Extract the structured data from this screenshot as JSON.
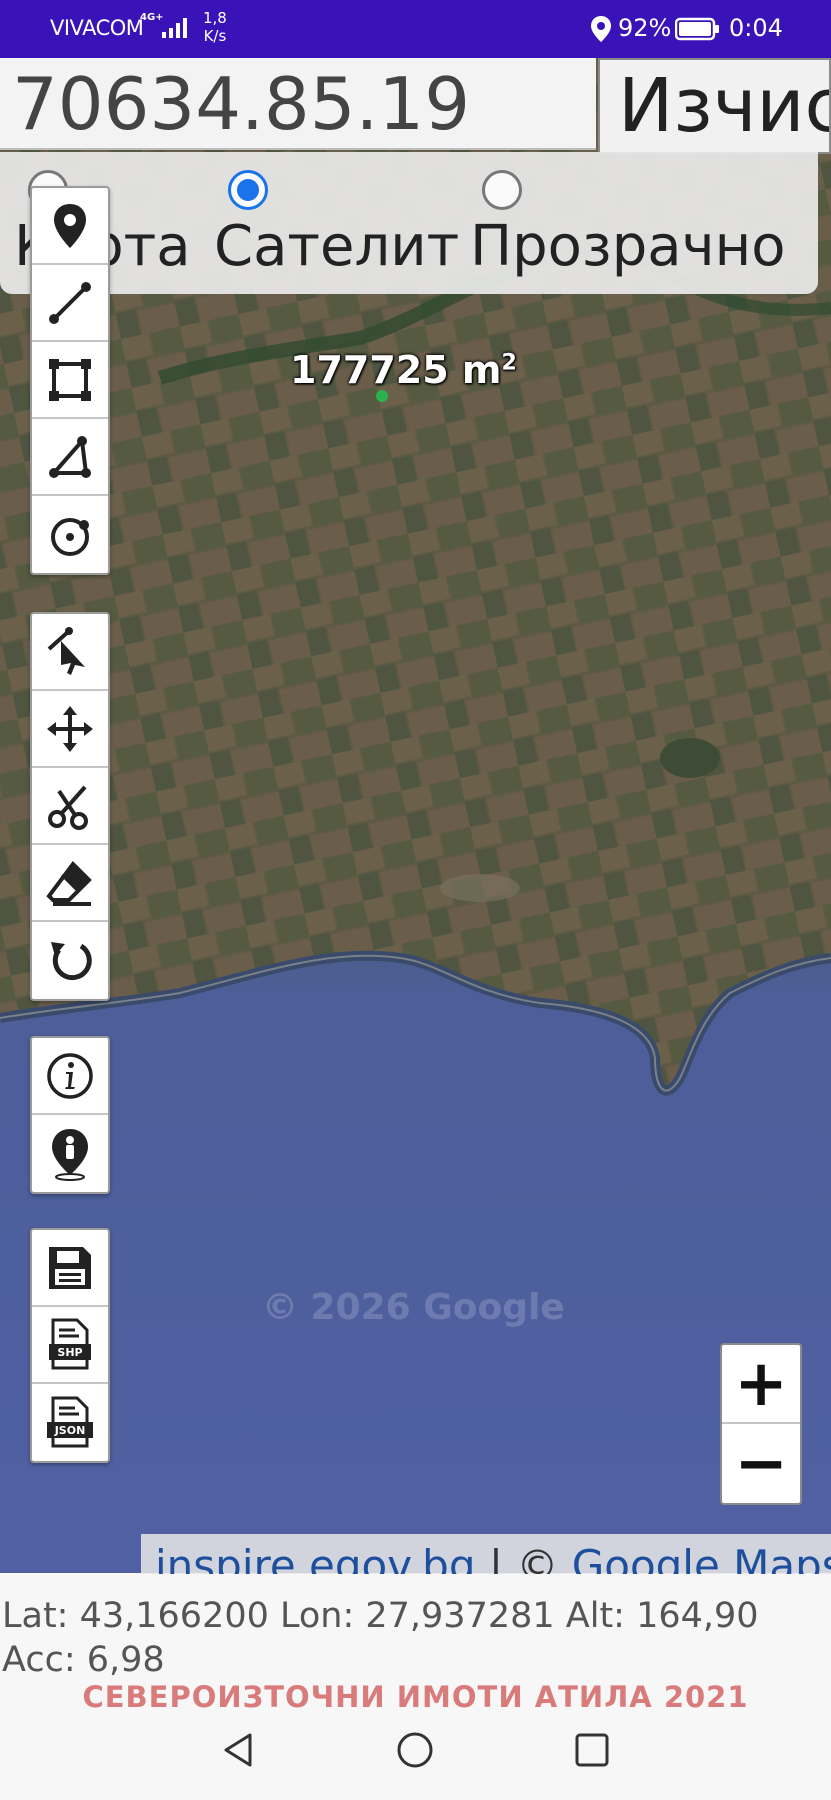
{
  "status_bar": {
    "carrier": "VIVACOM",
    "network": "4G+",
    "speed_value": "1,8",
    "speed_unit": "K/s",
    "battery": "92%",
    "time": "0:04"
  },
  "top": {
    "coord_input_value": "70634.85.19",
    "calc_button_label": "Изчис"
  },
  "layers": {
    "options": [
      {
        "label": "Карта",
        "checked": false
      },
      {
        "label": "Сателит",
        "checked": true
      },
      {
        "label": "Прозрачно",
        "checked": false
      }
    ]
  },
  "map": {
    "area_value": "177725 m",
    "area_sup": "2",
    "watermark": "© 2026 Google",
    "attribution_link1": "inspire.egov.bg",
    "attribution_sep": " | © ",
    "attribution_link2": "Google Maps"
  },
  "toolbar_groups": [
    [
      "marker-icon",
      "line-icon",
      "rectangle-icon",
      "angle-icon",
      "circle-icon"
    ],
    [
      "select-icon",
      "move-icon",
      "cut-icon",
      "eraser-icon",
      "undo-icon"
    ],
    [
      "info-icon",
      "my-location-icon"
    ],
    [
      "save-icon",
      "shp-export-icon",
      "json-export-icon"
    ]
  ],
  "zoom": {
    "in": "+",
    "out": "−"
  },
  "gps": {
    "text": "Lat: 43,166200 Lon: 27,937281 Alt: 164,90 Acc: 6,98"
  },
  "footer": "СЕВЕРОИЗТОЧНИ ИМОТИ АТИЛА 2021",
  "colors": {
    "status_bar": "#3a13b8",
    "accent": "#1a73e8",
    "footer": "#d97b7b"
  }
}
